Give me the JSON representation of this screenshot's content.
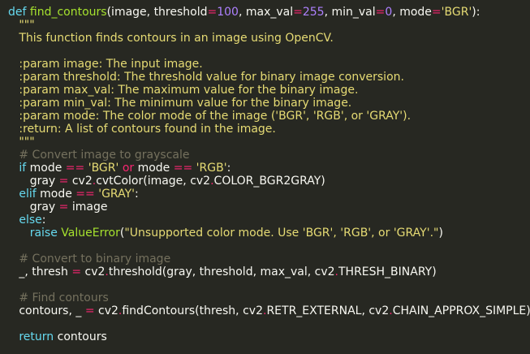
{
  "editor": {
    "language": "python",
    "theme": "monokai",
    "colors": {
      "background": "#272822",
      "keyword": "#66d9ef",
      "function_name": "#a6e22e",
      "number": "#ae81ff",
      "string": "#e6db74",
      "operator": "#f92672",
      "comment": "#75715e",
      "default": "#f8f8f2"
    },
    "lines": [
      {
        "indent": 0,
        "tokens": [
          {
            "c": "t-def",
            "t": "def "
          },
          {
            "c": "t-fn",
            "t": "find_contours"
          },
          {
            "c": "t-var",
            "t": "(image, threshold"
          },
          {
            "c": "t-op",
            "t": "="
          },
          {
            "c": "t-num",
            "t": "100"
          },
          {
            "c": "t-var",
            "t": ", max_val"
          },
          {
            "c": "t-op",
            "t": "="
          },
          {
            "c": "t-num",
            "t": "255"
          },
          {
            "c": "t-var",
            "t": ", min_val"
          },
          {
            "c": "t-op",
            "t": "="
          },
          {
            "c": "t-num",
            "t": "0"
          },
          {
            "c": "t-var",
            "t": ", mode"
          },
          {
            "c": "t-op",
            "t": "="
          },
          {
            "c": "t-str",
            "t": "'BGR'"
          },
          {
            "c": "t-var",
            "t": "):"
          }
        ]
      },
      {
        "indent": 1,
        "tokens": [
          {
            "c": "t-doc",
            "t": "\"\"\""
          }
        ]
      },
      {
        "indent": 1,
        "tokens": [
          {
            "c": "t-doc",
            "t": "This function finds contours in an image using OpenCV."
          }
        ]
      },
      {
        "indent": 0,
        "tokens": []
      },
      {
        "indent": 1,
        "tokens": [
          {
            "c": "t-doc",
            "t": ":param image: The input image."
          }
        ]
      },
      {
        "indent": 1,
        "tokens": [
          {
            "c": "t-doc",
            "t": ":param threshold: The threshold value for binary image conversion."
          }
        ]
      },
      {
        "indent": 1,
        "tokens": [
          {
            "c": "t-doc",
            "t": ":param max_val: The maximum value for the binary image."
          }
        ]
      },
      {
        "indent": 1,
        "tokens": [
          {
            "c": "t-doc",
            "t": ":param min_val: The minimum value for the binary image."
          }
        ]
      },
      {
        "indent": 1,
        "tokens": [
          {
            "c": "t-doc",
            "t": ":param mode: The color mode of the image ('BGR', 'RGB', or 'GRAY')."
          }
        ]
      },
      {
        "indent": 1,
        "tokens": [
          {
            "c": "t-doc",
            "t": ":return: A list of contours found in the image."
          }
        ]
      },
      {
        "indent": 1,
        "tokens": [
          {
            "c": "t-doc",
            "t": "\"\"\""
          }
        ]
      },
      {
        "indent": 1,
        "tokens": [
          {
            "c": "t-com",
            "t": "# Convert image to grayscale"
          }
        ]
      },
      {
        "indent": 1,
        "tokens": [
          {
            "c": "t-kw",
            "t": "if "
          },
          {
            "c": "t-var",
            "t": "mode "
          },
          {
            "c": "t-op",
            "t": "=="
          },
          {
            "c": "t-var",
            "t": " "
          },
          {
            "c": "t-str",
            "t": "'BGR'"
          },
          {
            "c": "t-var",
            "t": " "
          },
          {
            "c": "t-op",
            "t": "or"
          },
          {
            "c": "t-var",
            "t": " mode "
          },
          {
            "c": "t-op",
            "t": "=="
          },
          {
            "c": "t-var",
            "t": " "
          },
          {
            "c": "t-str",
            "t": "'RGB'"
          },
          {
            "c": "t-var",
            "t": ":"
          }
        ]
      },
      {
        "indent": 2,
        "tokens": [
          {
            "c": "t-var",
            "t": "gray "
          },
          {
            "c": "t-op",
            "t": "="
          },
          {
            "c": "t-var",
            "t": " cv2"
          },
          {
            "c": "t-op",
            "t": "."
          },
          {
            "c": "t-var",
            "t": "cvtColor(image, cv2"
          },
          {
            "c": "t-op",
            "t": "."
          },
          {
            "c": "t-var",
            "t": "COLOR_BGR2GRAY)"
          }
        ]
      },
      {
        "indent": 1,
        "tokens": [
          {
            "c": "t-kw",
            "t": "elif "
          },
          {
            "c": "t-var",
            "t": "mode "
          },
          {
            "c": "t-op",
            "t": "=="
          },
          {
            "c": "t-var",
            "t": " "
          },
          {
            "c": "t-str",
            "t": "'GRAY'"
          },
          {
            "c": "t-var",
            "t": ":"
          }
        ]
      },
      {
        "indent": 2,
        "tokens": [
          {
            "c": "t-var",
            "t": "gray "
          },
          {
            "c": "t-op",
            "t": "="
          },
          {
            "c": "t-var",
            "t": " image"
          }
        ]
      },
      {
        "indent": 1,
        "tokens": [
          {
            "c": "t-kw",
            "t": "else"
          },
          {
            "c": "t-var",
            "t": ":"
          }
        ]
      },
      {
        "indent": 2,
        "tokens": [
          {
            "c": "t-kw",
            "t": "raise "
          },
          {
            "c": "t-cls",
            "t": "ValueError"
          },
          {
            "c": "t-var",
            "t": "("
          },
          {
            "c": "t-str",
            "t": "\"Unsupported color mode. Use 'BGR', 'RGB', or 'GRAY'.\""
          },
          {
            "c": "t-var",
            "t": ")"
          }
        ]
      },
      {
        "indent": 0,
        "tokens": []
      },
      {
        "indent": 1,
        "tokens": [
          {
            "c": "t-com",
            "t": "# Convert to binary image"
          }
        ]
      },
      {
        "indent": 1,
        "tokens": [
          {
            "c": "t-var",
            "t": "_, thresh "
          },
          {
            "c": "t-op",
            "t": "="
          },
          {
            "c": "t-var",
            "t": " cv2"
          },
          {
            "c": "t-op",
            "t": "."
          },
          {
            "c": "t-var",
            "t": "threshold(gray, threshold, max_val, cv2"
          },
          {
            "c": "t-op",
            "t": "."
          },
          {
            "c": "t-var",
            "t": "THRESH_BINARY)"
          }
        ]
      },
      {
        "indent": 0,
        "tokens": []
      },
      {
        "indent": 1,
        "tokens": [
          {
            "c": "t-com",
            "t": "# Find contours"
          }
        ]
      },
      {
        "indent": 1,
        "tokens": [
          {
            "c": "t-var",
            "t": "contours, _ "
          },
          {
            "c": "t-op",
            "t": "="
          },
          {
            "c": "t-var",
            "t": " cv2"
          },
          {
            "c": "t-op",
            "t": "."
          },
          {
            "c": "t-var",
            "t": "findContours(thresh, cv2"
          },
          {
            "c": "t-op",
            "t": "."
          },
          {
            "c": "t-var",
            "t": "RETR_EXTERNAL, cv2"
          },
          {
            "c": "t-op",
            "t": "."
          },
          {
            "c": "t-var",
            "t": "CHAIN_APPROX_SIMPLE)"
          }
        ]
      },
      {
        "indent": 0,
        "tokens": []
      },
      {
        "indent": 1,
        "tokens": [
          {
            "c": "t-kw",
            "t": "return "
          },
          {
            "c": "t-var",
            "t": "contours"
          }
        ]
      }
    ]
  }
}
